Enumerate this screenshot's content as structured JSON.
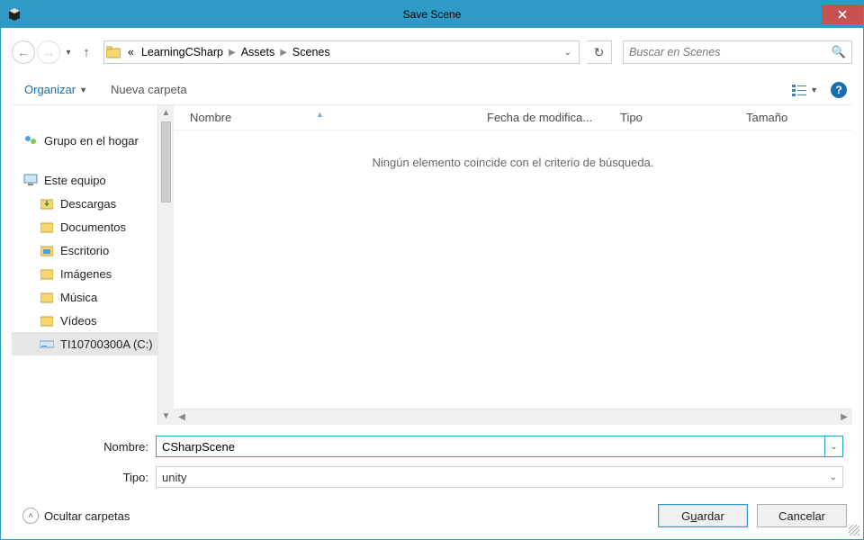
{
  "title": "Save Scene",
  "breadcrumbs": {
    "ellipsis": "«",
    "b1": "LearningCSharp",
    "b2": "Assets",
    "b3": "Scenes"
  },
  "search": {
    "placeholder": "Buscar en Scenes"
  },
  "toolbar": {
    "organize": "Organizar",
    "newfolder": "Nueva carpeta"
  },
  "tree": {
    "homegroup": "Grupo en el hogar",
    "thispc": "Este equipo",
    "downloads": "Descargas",
    "documents": "Documentos",
    "desktop": "Escritorio",
    "pictures": "Imágenes",
    "music": "Música",
    "videos": "Vídeos",
    "drive": "TI10700300A (C:)"
  },
  "columns": {
    "name": "Nombre",
    "date": "Fecha de modifica...",
    "type": "Tipo",
    "size": "Tamaño"
  },
  "emptyMessage": "Ningún elemento coincide con el criterio de búsqueda.",
  "form": {
    "nameLabel": "Nombre:",
    "nameValue": "CSharpScene",
    "typeLabel": "Tipo:",
    "typeValue": "unity"
  },
  "footer": {
    "hideFolders": "Ocultar carpetas",
    "save_pre": "G",
    "save_u": "u",
    "save_post": "ardar",
    "cancel": "Cancelar"
  }
}
